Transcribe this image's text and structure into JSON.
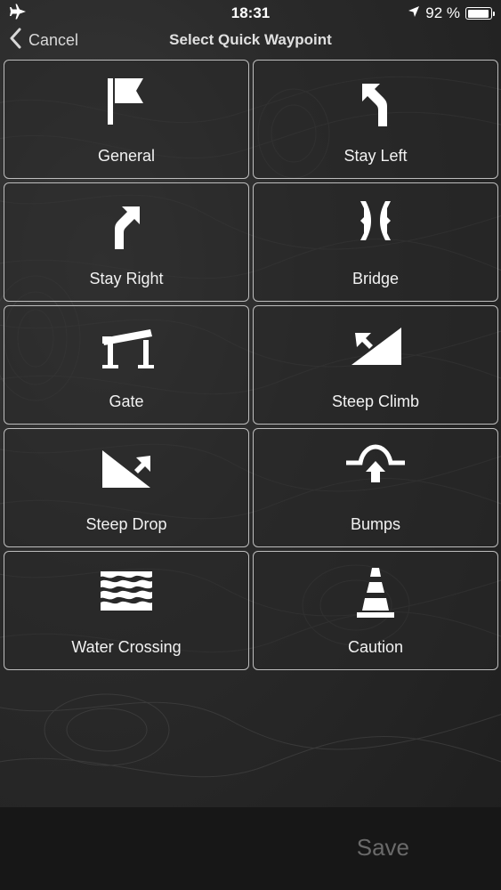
{
  "status_bar": {
    "time": "18:31",
    "battery_text": "92 %",
    "battery_level": 0.92,
    "airplane_icon": "airplane-icon",
    "location_icon": "location-arrow-icon"
  },
  "nav": {
    "back_label": "Cancel",
    "title": "Select Quick Waypoint"
  },
  "waypoints": [
    {
      "label": "General",
      "icon": "flag-icon"
    },
    {
      "label": "Stay Left",
      "icon": "stay-left-arrow-icon"
    },
    {
      "label": "Stay Right",
      "icon": "stay-right-arrow-icon"
    },
    {
      "label": "Bridge",
      "icon": "bridge-icon"
    },
    {
      "label": "Gate",
      "icon": "gate-icon"
    },
    {
      "label": "Steep Climb",
      "icon": "steep-climb-icon"
    },
    {
      "label": "Steep Drop",
      "icon": "steep-drop-icon"
    },
    {
      "label": "Bumps",
      "icon": "bumps-icon"
    },
    {
      "label": "Water Crossing",
      "icon": "water-crossing-icon"
    },
    {
      "label": "Caution",
      "icon": "caution-cone-icon"
    }
  ],
  "footer": {
    "save_label": "Save"
  },
  "colors": {
    "background": "#2a2a2a",
    "tile_border": "#bdbdbd",
    "save_disabled": "#6a6a6a"
  }
}
